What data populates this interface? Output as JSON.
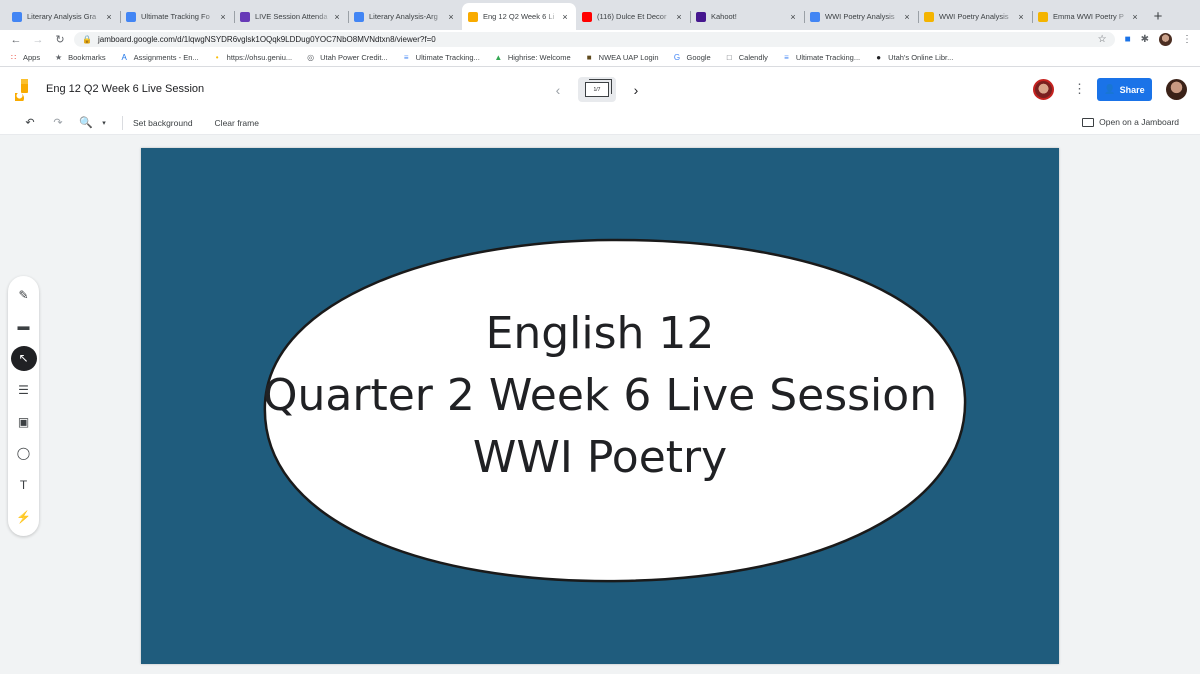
{
  "browser": {
    "tabs": [
      {
        "title": "Literary Analysis Gra",
        "favicon": "docs-icon",
        "color": "#4285f4",
        "active": false
      },
      {
        "title": "Ultimate Tracking Fo",
        "favicon": "docs-icon",
        "color": "#4285f4",
        "active": false
      },
      {
        "title": "LIVE Session Attenda",
        "favicon": "forms-icon",
        "color": "#673ab7",
        "active": false
      },
      {
        "title": "Literary Analysis-Arg",
        "favicon": "docs-icon",
        "color": "#4285f4",
        "active": false
      },
      {
        "title": "Eng 12 Q2 Week 6 Li",
        "favicon": "jamboard-icon",
        "color": "#f9ab00",
        "active": true
      },
      {
        "title": "(116) Dulce Et Decor",
        "favicon": "youtube-icon",
        "color": "#ff0000",
        "active": false
      },
      {
        "title": "Kahoot!",
        "favicon": "kahoot-icon",
        "color": "#46178f",
        "active": false
      },
      {
        "title": "WWI Poetry Analysis",
        "favicon": "docs-icon",
        "color": "#4285f4",
        "active": false
      },
      {
        "title": "WWI Poetry Analysis",
        "favicon": "slides-icon",
        "color": "#f4b400",
        "active": false
      },
      {
        "title": "Emma WWI Poetry P",
        "favicon": "slides-icon",
        "color": "#f4b400",
        "active": false
      }
    ],
    "new_tab": "+",
    "url": "jamboard.google.com/d/1lqwgNSYDR6vglsk1OQqk9LDDug0YOC7NbO8MVNdtxn8/viewer?f=0",
    "bookmarks": [
      {
        "label": "Apps",
        "icon": "apps-grid-icon",
        "color": "#ea4335"
      },
      {
        "label": "Bookmarks",
        "icon": "star-icon",
        "color": "#5f6368"
      },
      {
        "label": "Assignments - En...",
        "icon": "assignments-icon",
        "color": "#1a73e8"
      },
      {
        "label": "https://ohsu.geniu...",
        "icon": "lightbulb-icon",
        "color": "#fbbc04"
      },
      {
        "label": "Utah Power Credit...",
        "icon": "credit-union-icon",
        "color": "#5f6368"
      },
      {
        "label": "Ultimate Tracking...",
        "icon": "docs-icon",
        "color": "#4285f4"
      },
      {
        "label": "Highrise: Welcome",
        "icon": "highrise-icon",
        "color": "#34a853"
      },
      {
        "label": "NWEA UAP Login",
        "icon": "nwea-icon",
        "color": "#5f4b1e"
      },
      {
        "label": "Google",
        "icon": "google-icon",
        "color": "#4285f4"
      },
      {
        "label": "Calendly",
        "icon": "calendly-icon",
        "color": "#5f6368"
      },
      {
        "label": "Ultimate Tracking...",
        "icon": "docs-icon",
        "color": "#4285f4"
      },
      {
        "label": "Utah's Online Libr...",
        "icon": "globe-icon",
        "color": "#202124"
      }
    ]
  },
  "jamboard": {
    "title": "Eng 12 Q2 Week 6 Live Session",
    "frame_counter": "1/7",
    "share_label": "Share",
    "toolbar": {
      "set_background": "Set background",
      "clear_frame": "Clear frame",
      "open_on_jamboard": "Open on a Jamboard"
    },
    "slide": {
      "line1": "English 12",
      "line2": "Quarter 2 Week 6 Live Session",
      "line3": "WWI Poetry",
      "background_color": "#1f5c7d",
      "ellipse_color": "#ffffff"
    },
    "side_tools": [
      "pen-icon",
      "eraser-icon",
      "select-icon",
      "sticky-note-icon",
      "image-icon",
      "circle-icon",
      "textbox-icon",
      "laser-icon"
    ],
    "accent": "#1a73e8"
  }
}
